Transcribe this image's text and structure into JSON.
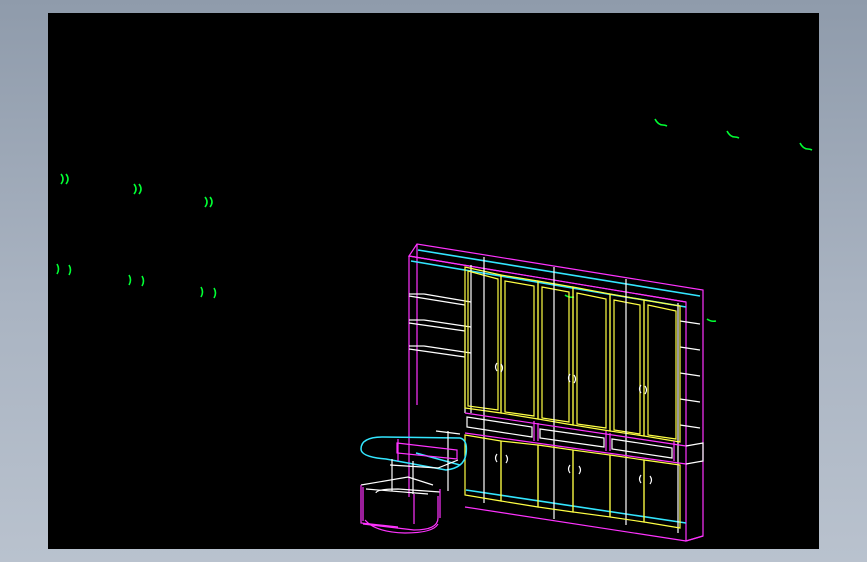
{
  "app": {
    "background": "#9aa5b4"
  },
  "viewport": {
    "background": "#000000"
  },
  "colors": {
    "magenta": "#ff33ff",
    "yellow": "#ffff44",
    "cyan": "#33e6ff",
    "white": "#ffffff",
    "green": "#00ff33"
  },
  "drawing": {
    "subject": "wardrobe-cabinet-wireframe",
    "markers": [
      "leaf-glyph",
      "leaf-glyph",
      "leaf-glyph",
      "bracket-glyph",
      "bracket-glyph",
      "bracket-glyph",
      "paren-glyph",
      "paren-glyph",
      "paren-glyph"
    ]
  }
}
